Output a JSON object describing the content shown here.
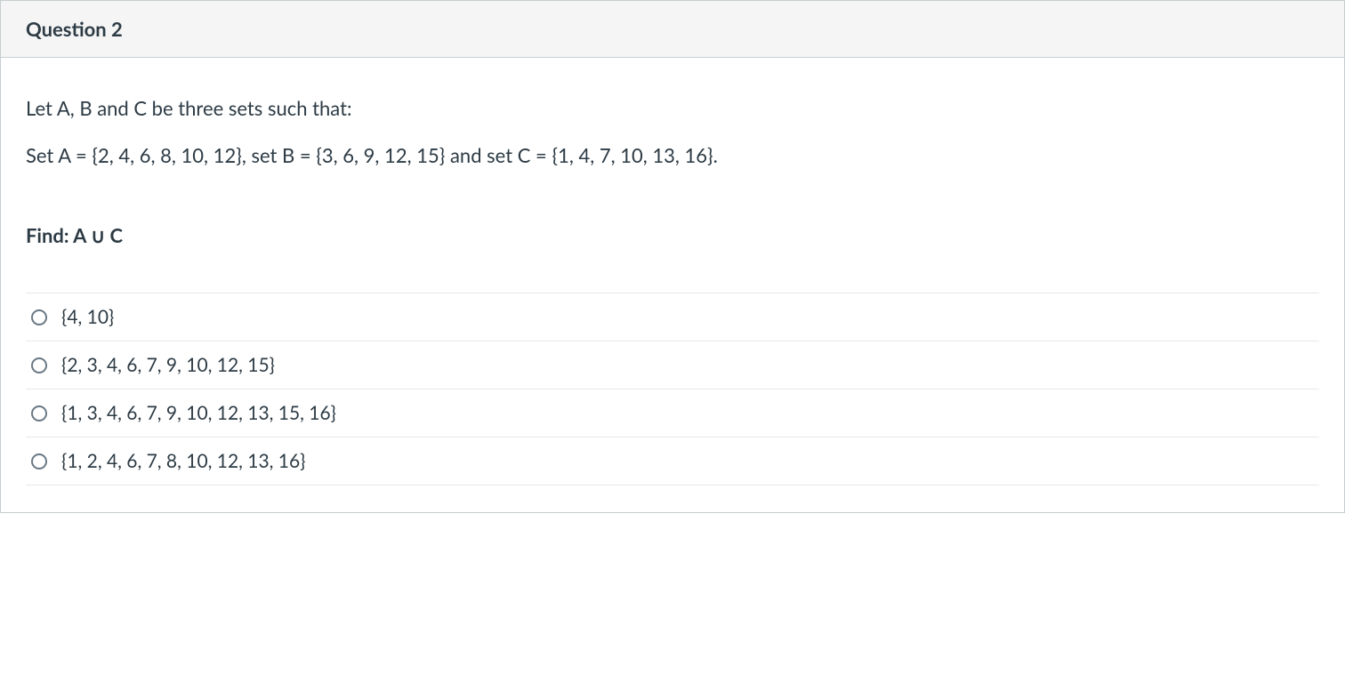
{
  "question": {
    "header": "Question 2",
    "prompt_line1": "Let A, B and C be three sets such that:",
    "prompt_line2": "Set A = {2, 4, 6, 8, 10, 12}, set B = {3, 6, 9, 12, 15} and set C = {1, 4, 7, 10, 13, 16}.",
    "find_label": "Find: A ∪ C",
    "answers": [
      "{4, 10}",
      "{2, 3, 4, 6, 7, 9, 10, 12, 15}",
      "{1, 3, 4, 6, 7, 9, 10, 12, 13, 15, 16}",
      "{1, 2, 4, 6, 7, 8, 10, 12, 13, 16}"
    ]
  }
}
